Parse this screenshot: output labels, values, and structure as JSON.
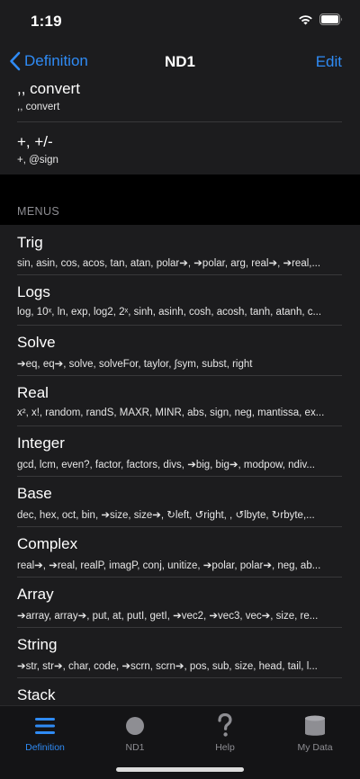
{
  "status_bar": {
    "time": "1:19"
  },
  "nav": {
    "back_label": "Definition",
    "title": "ND1",
    "edit_label": "Edit"
  },
  "top_items": [
    {
      "title": ",, convert",
      "subtitle": ",, convert"
    },
    {
      "title": "+, +/-",
      "subtitle": "+, @sign"
    }
  ],
  "section_header": "MENUS",
  "menus": [
    {
      "title": "Trig",
      "subtitle": "sin, asin, cos, acos, tan, atan, polar➔, ➔polar, arg, real➔, ➔real,..."
    },
    {
      "title": "Logs",
      "subtitle": "log, 10ˣ, ln, exp, log2, 2ˣ, sinh, asinh, cosh, acosh, tanh, atanh, c..."
    },
    {
      "title": "Solve",
      "subtitle": "➔eq, eq➔, solve, solveFor, taylor, ∫sym, subst, right"
    },
    {
      "title": "Real",
      "subtitle": "x², x!, random, randS, MAXR, MINR, abs, sign, neg, mantissa, ex..."
    },
    {
      "title": "Integer",
      "subtitle": "gcd, lcm, even?, factor, factors, divs, ➔big, big➔, modpow, ndiv..."
    },
    {
      "title": "Base",
      "subtitle": "dec, hex, oct, bin, ➔size, size➔, ↻left, ↺right, , ↺lbyte, ↻rbyte,..."
    },
    {
      "title": "Complex",
      "subtitle": "real➔, ➔real, realP, imagP, conj, unitize, ➔polar, polar➔, neg, ab..."
    },
    {
      "title": "Array",
      "subtitle": "➔array, array➔, put, at, putI, getI, ➔vec2, ➔vec3, vec➔, size, re..."
    },
    {
      "title": "String",
      "subtitle": "➔str, str➔, char, code, ➔scrn, scrn➔, pos, sub, size, head, tail, l..."
    },
    {
      "title": "Stack",
      "subtitle": ""
    }
  ],
  "tabs": [
    {
      "label": "Definition",
      "icon": "list-icon",
      "active": true
    },
    {
      "label": "ND1",
      "icon": "circle-icon",
      "active": false
    },
    {
      "label": "Help",
      "icon": "question-icon",
      "active": false
    },
    {
      "label": "My Data",
      "icon": "database-icon",
      "active": false
    }
  ],
  "colors": {
    "accent": "#2f8bf5",
    "background": "#000000",
    "cell": "#1c1c1e",
    "tab_inactive": "#8e8e93"
  }
}
